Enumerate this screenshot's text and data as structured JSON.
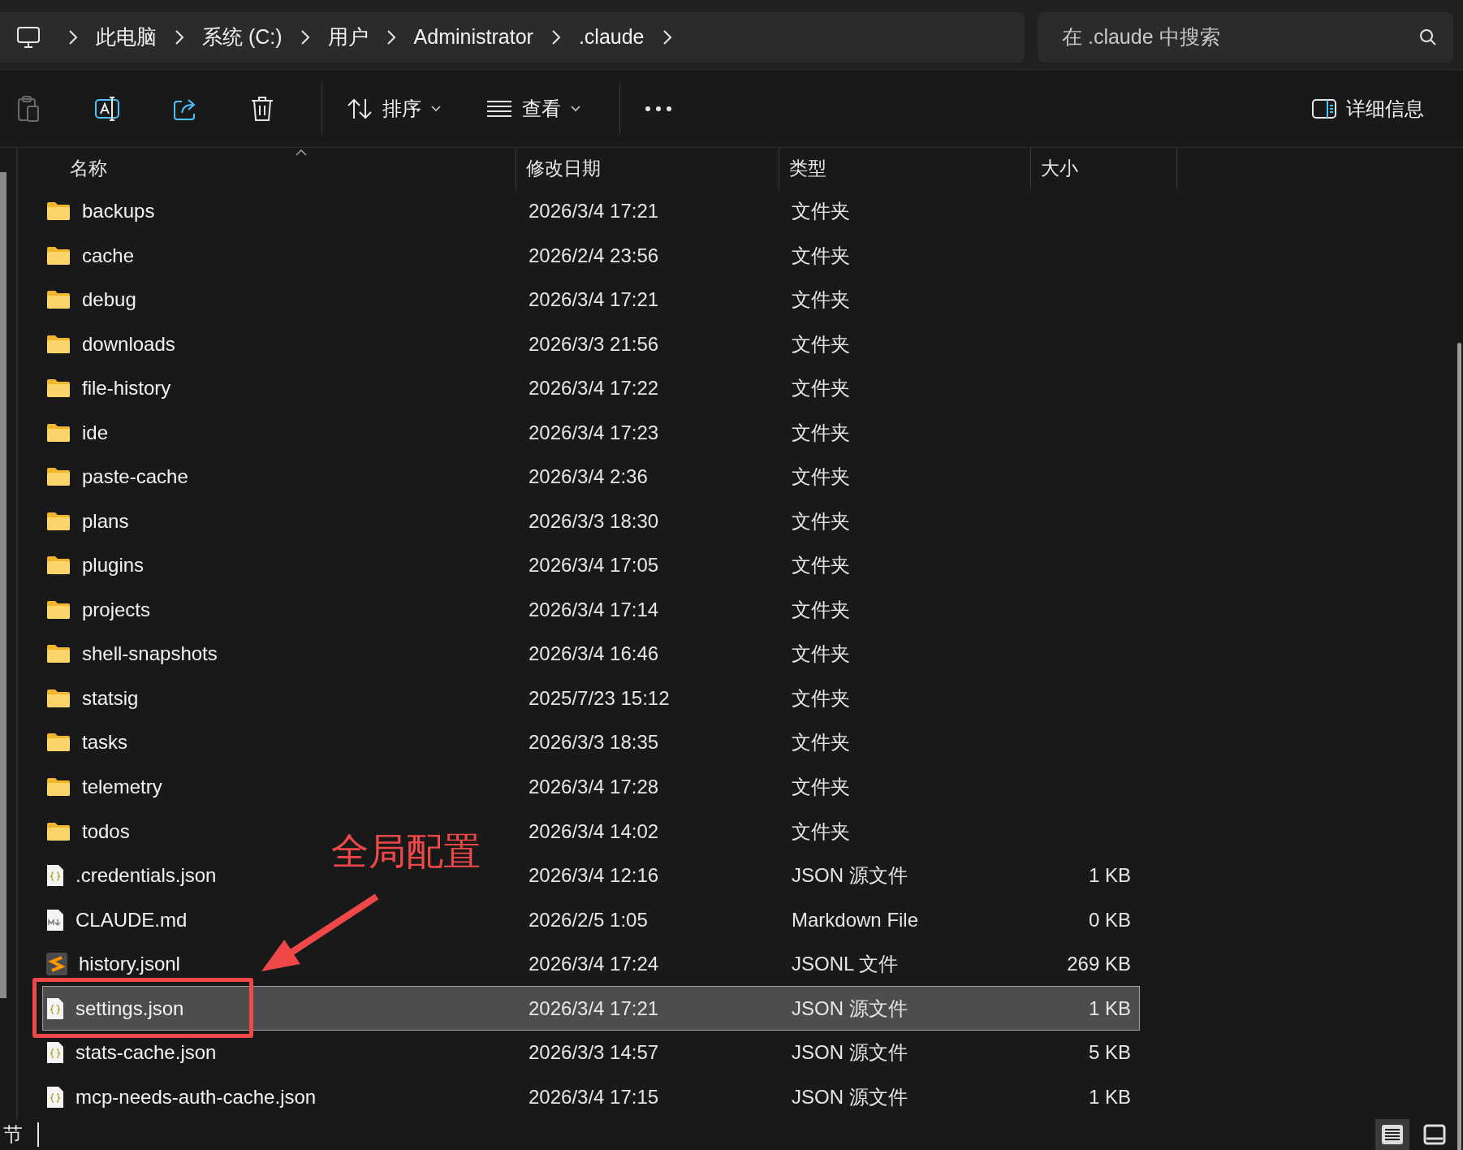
{
  "address_bar": {
    "breadcrumbs": [
      "此电脑",
      "系统 (C:)",
      "用户",
      "Administrator",
      ".claude"
    ]
  },
  "search": {
    "placeholder": "在 .claude 中搜索"
  },
  "toolbar": {
    "items": [
      {
        "kind": "paste",
        "disabled": true
      },
      {
        "kind": "rename",
        "disabled": false
      },
      {
        "kind": "share",
        "disabled": false
      },
      {
        "kind": "delete",
        "disabled": false
      },
      {
        "kind": "sort",
        "label": "排序",
        "disabled": false
      },
      {
        "kind": "view",
        "label": "查看",
        "disabled": false
      },
      {
        "kind": "more",
        "disabled": false
      }
    ],
    "details": {
      "label": "详细信息"
    }
  },
  "table": {
    "columns": [
      "名称",
      "修改日期",
      "类型",
      "大小"
    ],
    "rows": [
      {
        "kind": "folder",
        "name": "backups",
        "date": "2026/3/4 17:21",
        "type": "文件夹",
        "selected": false
      },
      {
        "kind": "folder",
        "name": "cache",
        "date": "2026/2/4 23:56",
        "type": "文件夹",
        "selected": false
      },
      {
        "kind": "folder",
        "name": "debug",
        "date": "2026/3/4 17:21",
        "type": "文件夹",
        "selected": false
      },
      {
        "kind": "folder",
        "name": "downloads",
        "date": "2026/3/3 21:56",
        "type": "文件夹",
        "selected": false
      },
      {
        "kind": "folder",
        "name": "file-history",
        "date": "2026/3/4 17:22",
        "type": "文件夹",
        "selected": false
      },
      {
        "kind": "folder",
        "name": "ide",
        "date": "2026/3/4 17:23",
        "type": "文件夹",
        "selected": false
      },
      {
        "kind": "folder",
        "name": "paste-cache",
        "date": "2026/3/4 2:36",
        "type": "文件夹",
        "selected": false
      },
      {
        "kind": "folder",
        "name": "plans",
        "date": "2026/3/3 18:30",
        "type": "文件夹",
        "selected": false
      },
      {
        "kind": "folder",
        "name": "plugins",
        "date": "2026/3/4 17:05",
        "type": "文件夹",
        "selected": false
      },
      {
        "kind": "folder",
        "name": "projects",
        "date": "2026/3/4 17:14",
        "type": "文件夹",
        "selected": false
      },
      {
        "kind": "folder",
        "name": "shell-snapshots",
        "date": "2026/3/4 16:46",
        "type": "文件夹",
        "selected": false
      },
      {
        "kind": "folder",
        "name": "statsig",
        "date": "2025/7/23 15:12",
        "type": "文件夹",
        "selected": false
      },
      {
        "kind": "folder",
        "name": "tasks",
        "date": "2026/3/3 18:35",
        "type": "文件夹",
        "selected": false
      },
      {
        "kind": "folder",
        "name": "telemetry",
        "date": "2026/3/4 17:28",
        "type": "文件夹",
        "selected": false
      },
      {
        "kind": "folder",
        "name": "todos",
        "date": "2026/3/4 14:02",
        "type": "文件夹",
        "selected": false
      },
      {
        "kind": "json",
        "name": ".credentials.json",
        "date": "2026/3/4 12:16",
        "type": "JSON 源文件",
        "size": "1 KB",
        "selected": false
      },
      {
        "kind": "markdown",
        "name": "CLAUDE.md",
        "date": "2026/2/5 1:05",
        "type": "Markdown File",
        "size": "0 KB",
        "selected": false
      },
      {
        "kind": "jsonl",
        "name": "history.jsonl",
        "date": "2026/3/4 17:24",
        "type": "JSONL 文件",
        "size": "269 KB",
        "selected": false
      },
      {
        "kind": "json",
        "name": "settings.json",
        "date": "2026/3/4 17:21",
        "type": "JSON 源文件",
        "size": "1 KB",
        "selected": true
      },
      {
        "kind": "json",
        "name": "stats-cache.json",
        "date": "2026/3/3 14:57",
        "type": "JSON 源文件",
        "size": "5 KB",
        "selected": false
      },
      {
        "kind": "json",
        "name": "mcp-needs-auth-cache.json",
        "date": "2026/3/4 17:15",
        "type": "JSON 源文件",
        "size": "1 KB",
        "selected": false
      }
    ]
  },
  "annotation": {
    "text": "全局配置"
  },
  "status_bar": {
    "text": "节",
    "views": [
      {
        "kind": "details",
        "selected": true
      },
      {
        "kind": "tiles",
        "selected": false
      }
    ]
  }
}
